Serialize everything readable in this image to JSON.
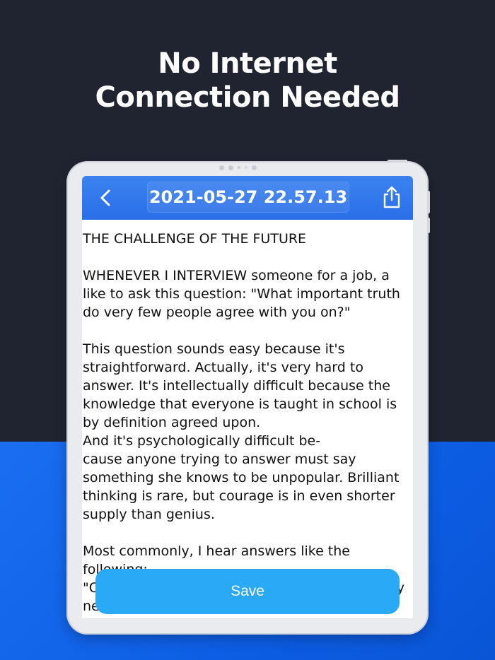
{
  "headline": {
    "line1": "No Internet",
    "line2": "Connection Needed"
  },
  "app": {
    "title": "2021-05-27 22.57.13",
    "back_icon": "chevron-left-icon",
    "share_icon": "share-icon",
    "save_label": "Save",
    "accent_color": "#2a6fe8",
    "button_color": "#2aa9f7"
  },
  "document": {
    "text": "THE CHALLENGE OF THE FUTURE\n\nWHENEVER I INTERVIEW someone for a job, a like to ask this question: \"What important truth do very few people agree with you on?\"\n\nThis question sounds easy because it's straightforward. Actually, it's very hard to answer. It's intellectually difficult because the knowledge that everyone is taught in school is by definition agreed upon.\nAnd it's psychologically difficult be-\ncause anyone trying to answer must say something she knows to be unpopular. Brilliant thinking is rare, but courage is in even shorter supply than genius.\n\nMost commonly, I hear answers like the following:\n\"Our educational system is broken and urgently needs to be fixed.\"\n\"America is exceptional.\""
  }
}
